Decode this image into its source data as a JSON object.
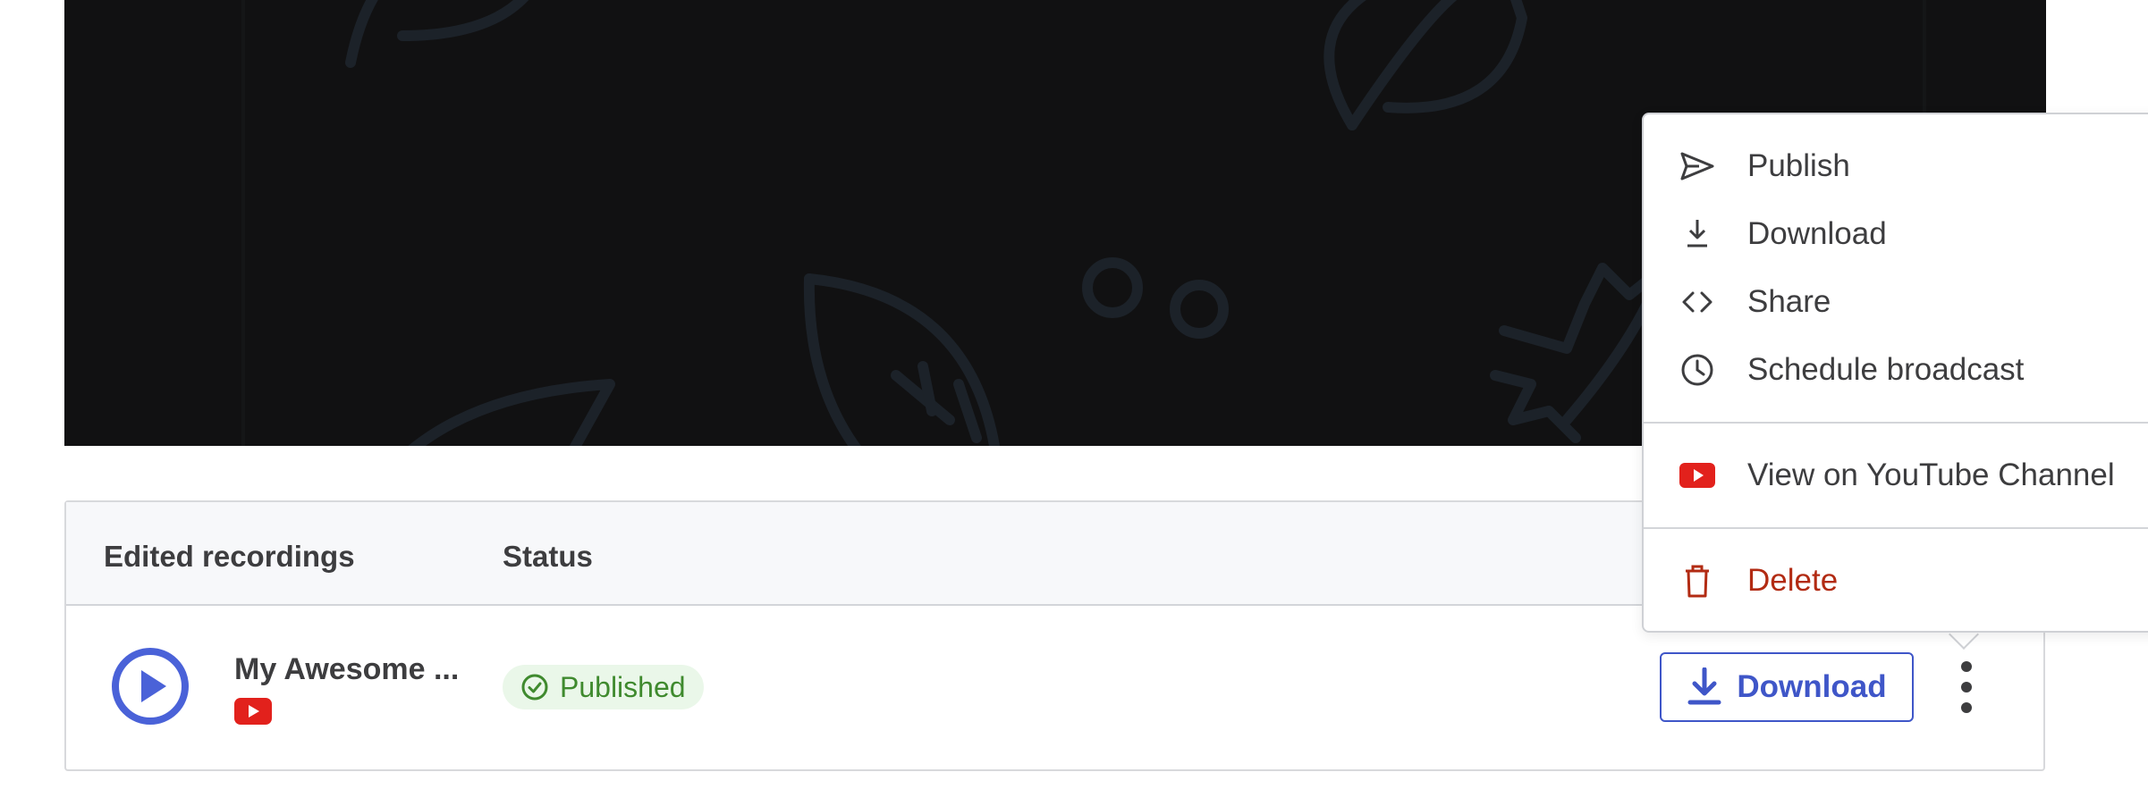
{
  "menu": {
    "items": [
      {
        "label": "Publish",
        "icon": "send-icon"
      },
      {
        "label": "Download",
        "icon": "download-icon"
      },
      {
        "label": "Share",
        "icon": "code-icon"
      },
      {
        "label": "Schedule broadcast",
        "icon": "clock-icon"
      },
      {
        "label": "View on YouTube Channel",
        "icon": "youtube-icon"
      },
      {
        "label": "Delete",
        "icon": "trash-icon"
      }
    ]
  },
  "table": {
    "headers": {
      "recordings": "Edited recordings",
      "status": "Status"
    },
    "rows": [
      {
        "title": "My Awesome ...",
        "platform_icon": "youtube-icon",
        "status": "Published",
        "download_label": "Download"
      }
    ]
  },
  "colors": {
    "accent": "#3f56c8",
    "play": "#4a62d8",
    "published_text": "#3f8a2e",
    "published_bg": "#eaf7e9",
    "youtube": "#e2211c",
    "danger": "#b22b13",
    "video_bg": "#111112"
  }
}
